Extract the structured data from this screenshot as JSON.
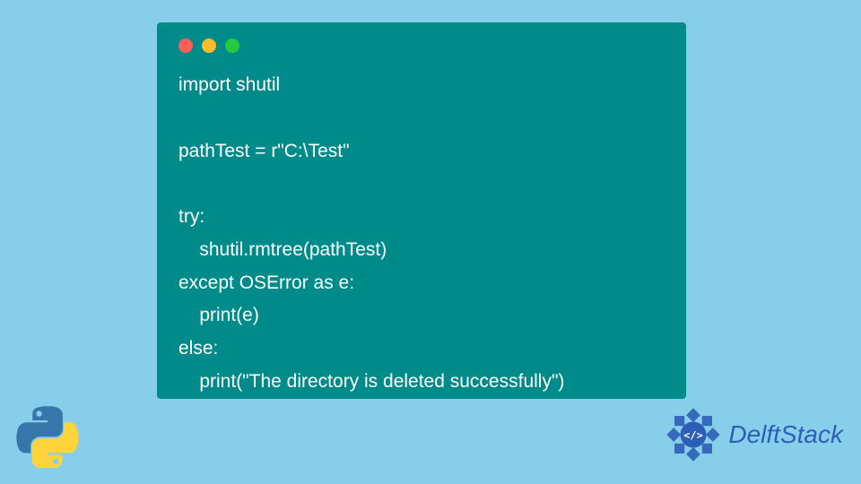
{
  "code": {
    "lines": [
      "import shutil",
      "",
      "pathTest = r\"C:\\Test\"",
      "",
      "try:",
      "    shutil.rmtree(pathTest)",
      "except OSError as e:",
      "    print(e)",
      "else:",
      "    print(\"The directory is deleted successfully\")"
    ]
  },
  "branding": {
    "site_name": "DelftStack"
  },
  "colors": {
    "background": "#87CEEB",
    "window": "#008B8B",
    "text": "#FFFFFF",
    "brand": "#2E5FB7"
  }
}
